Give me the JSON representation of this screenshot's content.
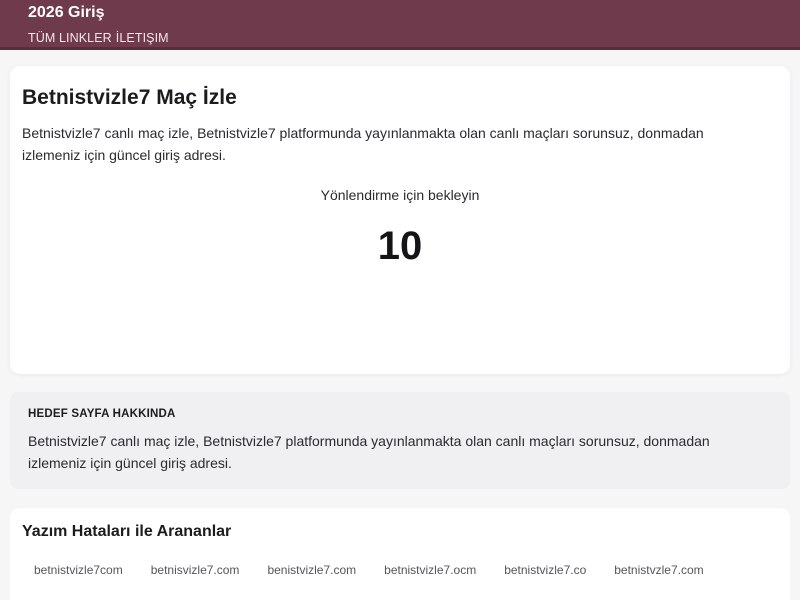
{
  "header": {
    "brand": "2026 Giriş",
    "nav": [
      "TÜM LINKLER",
      "İLETIŞIM"
    ]
  },
  "main": {
    "title": "Betnistvizle7 Maç İzle",
    "description": "Betnistvizle7 canlı maç izle, Betnistvizle7 platformunda yayınlanmakta olan canlı maçları sorunsuz, donmadan izlemeniz için güncel giriş adresi.",
    "redirect_label": "Yönlendirme için bekleyin",
    "countdown": "10"
  },
  "about": {
    "title": "HEDEF SAYFA HAKKINDA",
    "description": "Betnistvizle7 canlı maç izle, Betnistvizle7 platformunda yayınlanmakta olan canlı maçları sorunsuz, donmadan izlemeniz için güncel giriş adresi."
  },
  "typos": {
    "title": "Yazım Hataları ile Arananlar",
    "items": [
      "betnistvizle7com",
      "betnisvizle7.com",
      "benistvizle7.com",
      "betnistvizle7.ocm",
      "betnistvizle7.co",
      "betnistvzle7.com"
    ]
  },
  "colors": {
    "header_bg": "#6f3a4c",
    "page_bg": "#f6f6f7",
    "card_bg": "#ffffff",
    "about_bg": "#f0f0f2"
  }
}
